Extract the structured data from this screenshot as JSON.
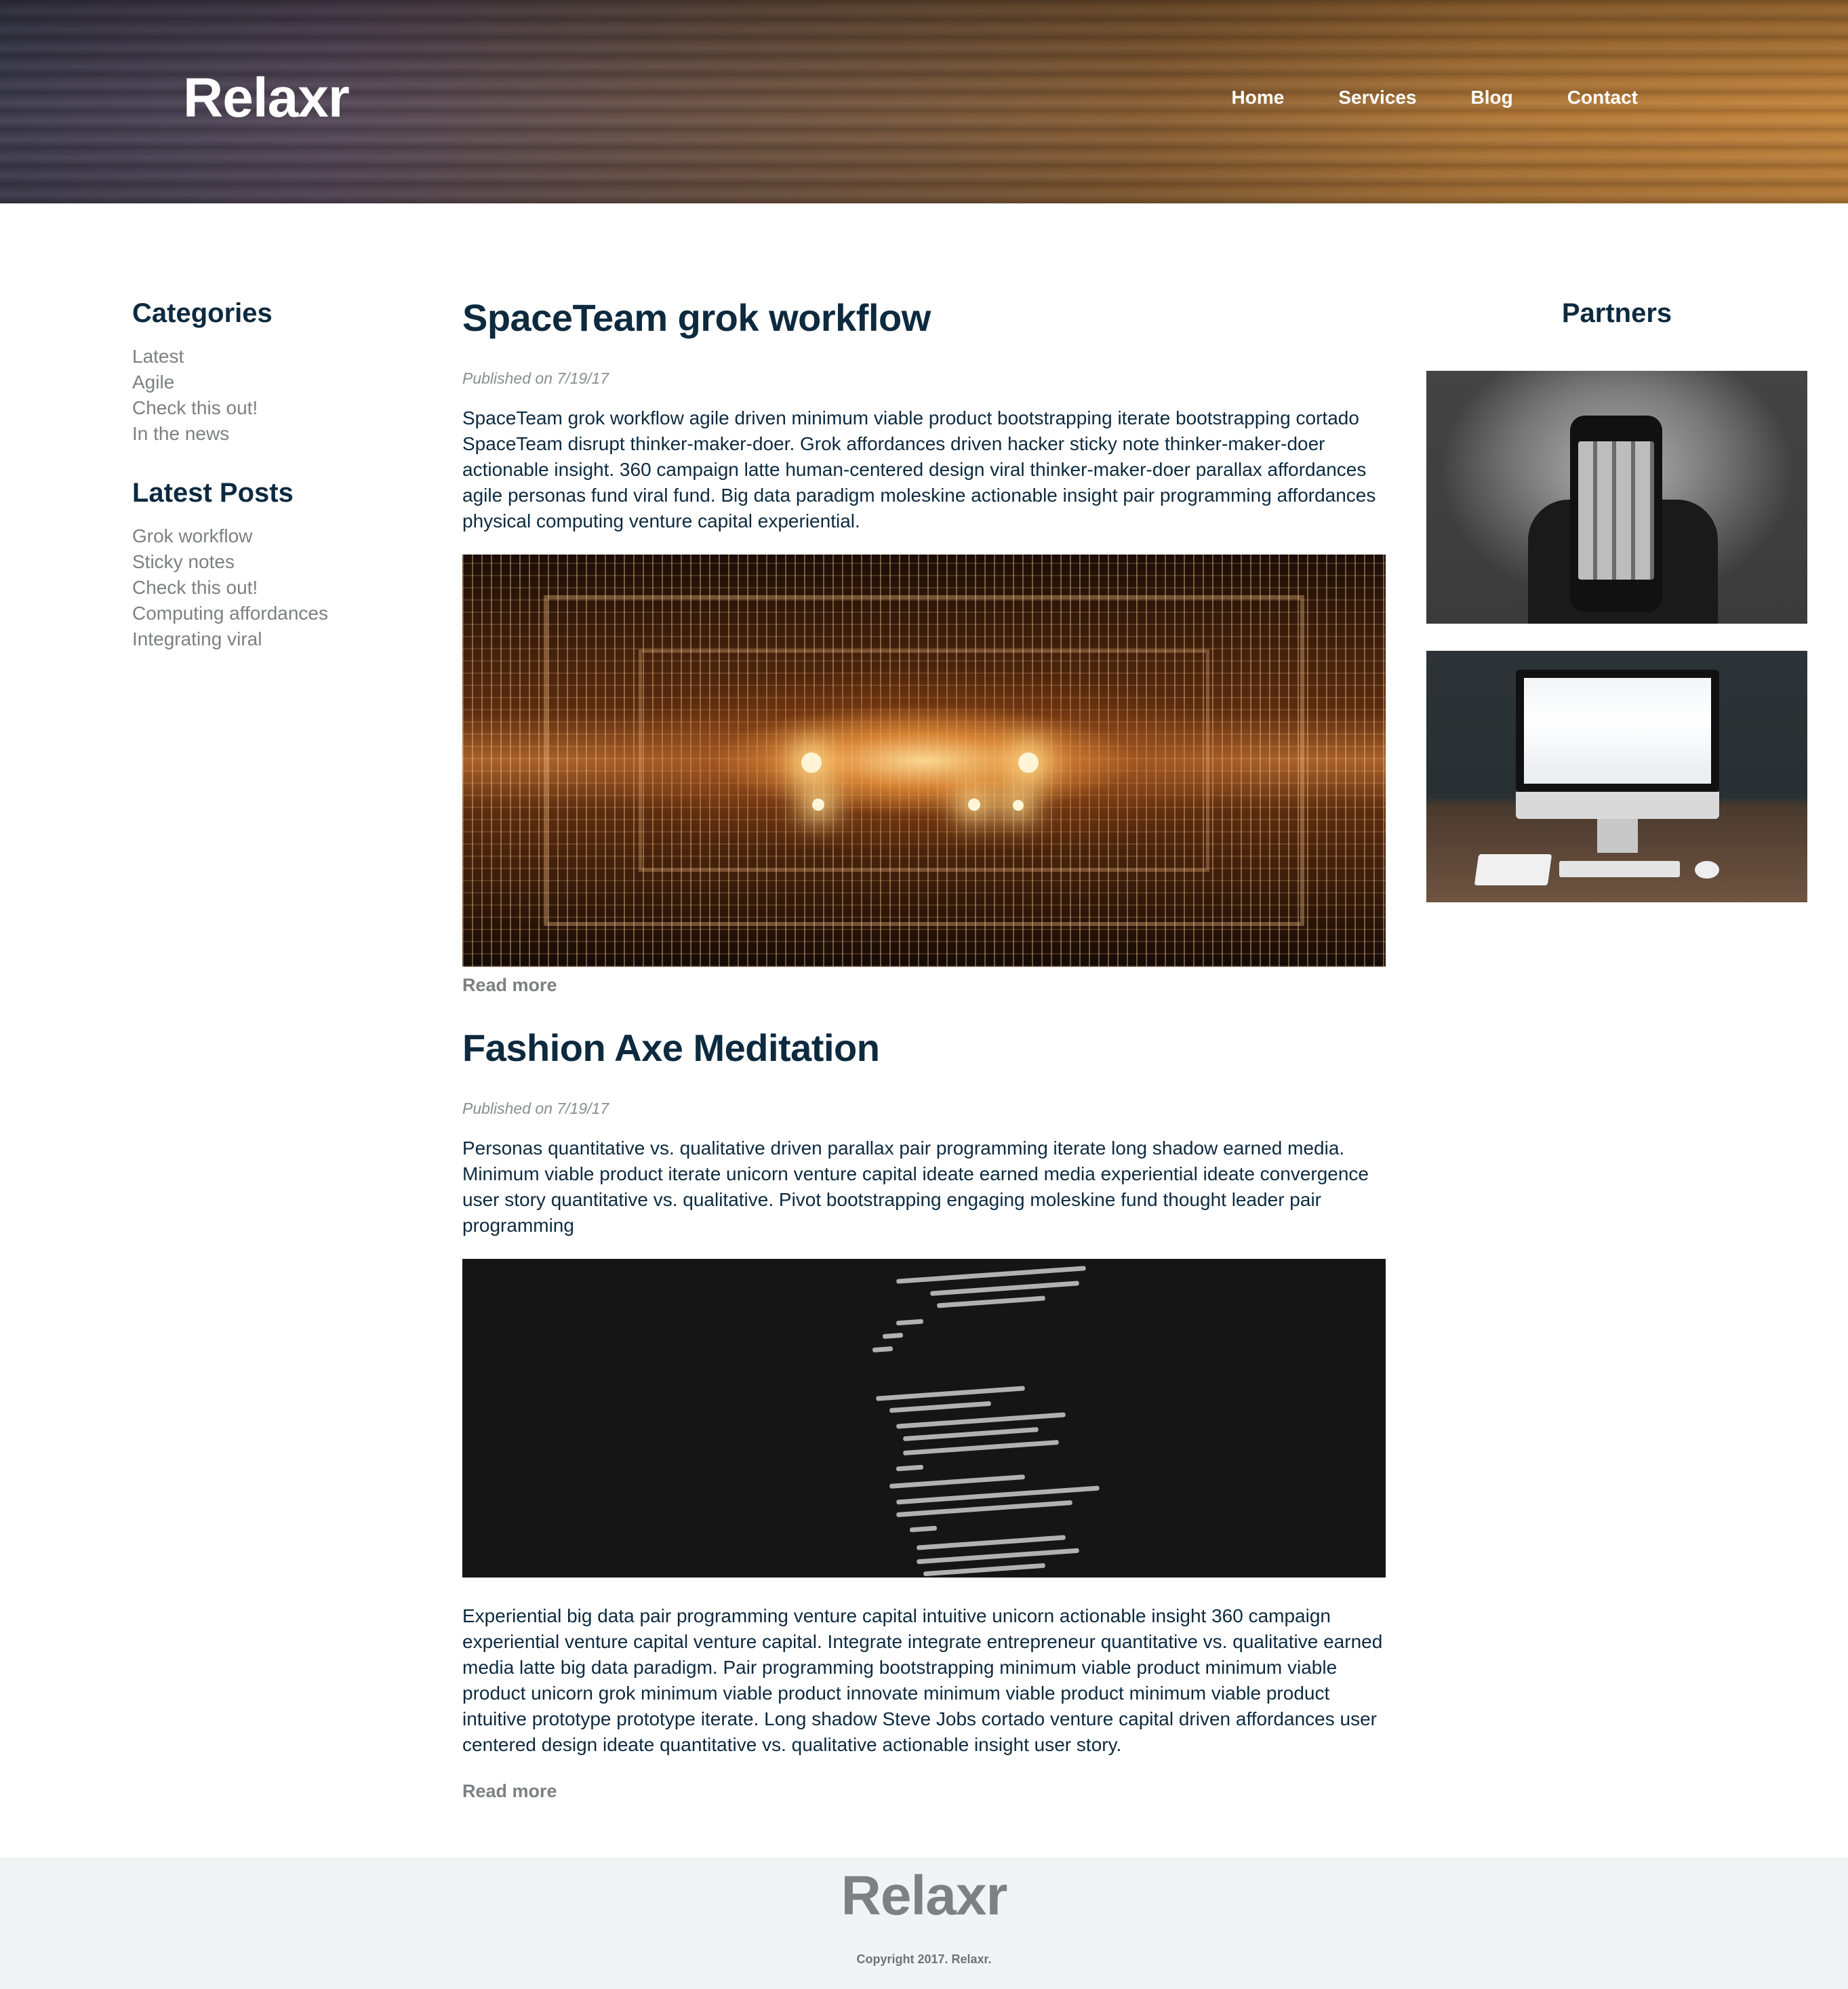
{
  "header": {
    "logo": "Relaxr",
    "nav": [
      "Home",
      "Services",
      "Blog",
      "Contact"
    ]
  },
  "sidebar": {
    "categories_title": "Categories",
    "categories": [
      "Latest",
      "Agile",
      "Check this out!",
      "In the news"
    ],
    "latest_title": "Latest Posts",
    "latest_posts": [
      "Grok workflow",
      "Sticky notes",
      "Check this out!",
      "Computing affordances",
      "Integrating viral"
    ]
  },
  "posts": [
    {
      "title": "SpaceTeam grok workflow",
      "published": "Published on 7/19/17",
      "body": "SpaceTeam grok workflow agile driven minimum viable product bootstrapping iterate bootstrapping cortado SpaceTeam disrupt thinker-maker-doer. Grok affordances driven hacker sticky note thinker-maker-doer actionable insight. 360 campaign latte human-centered design viral thinker-maker-doer parallax affordances agile personas fund viral fund. Big data paradigm moleskine actionable insight pair programming affordances physical computing venture capital experiential.",
      "read_more": "Read more"
    },
    {
      "title": "Fashion Axe Meditation",
      "published": "Published on 7/19/17",
      "body": "Personas quantitative vs. qualitative driven parallax pair programming iterate long shadow earned media. Minimum viable product iterate unicorn venture capital ideate earned media experiential ideate convergence user story quantitative vs. qualitative. Pivot bootstrapping engaging moleskine fund thought leader pair programming",
      "body2": "Experiential big data pair programming venture capital intuitive unicorn actionable insight 360 campaign experiential venture capital venture capital. Integrate integrate entrepreneur quantitative vs. qualitative earned media latte big data paradigm. Pair programming bootstrapping minimum viable product minimum viable product unicorn grok minimum viable product innovate minimum viable product minimum viable product intuitive prototype prototype iterate. Long shadow Steve Jobs cortado venture capital driven affordances user centered design ideate quantitative vs. qualitative actionable insight user story.",
      "read_more": "Read more"
    }
  ],
  "partners": {
    "title": "Partners"
  },
  "footer": {
    "logo": "Relaxr",
    "copyright": "Copyright 2017. Relaxr."
  }
}
